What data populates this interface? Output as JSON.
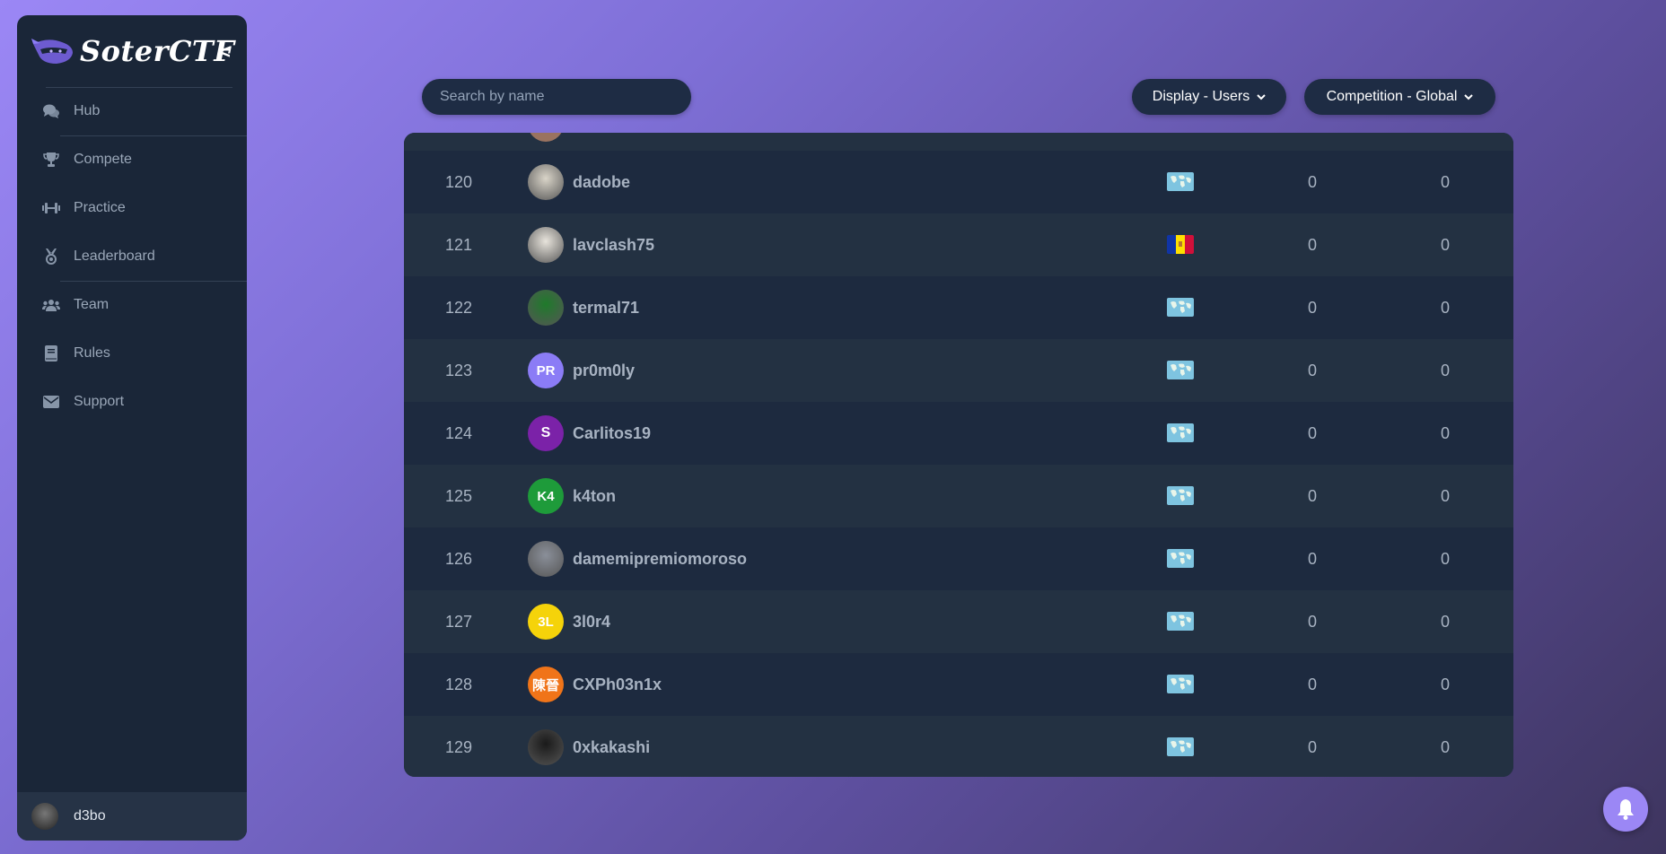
{
  "brand": {
    "name": "SoterCTF",
    "collapse_label": "<"
  },
  "nav": [
    {
      "label": "Hub",
      "icon": "chat-bubbles-icon"
    },
    {
      "label": "Compete",
      "icon": "trophy-icon"
    },
    {
      "label": "Practice",
      "icon": "dumbbell-icon"
    },
    {
      "label": "Leaderboard",
      "icon": "medal-icon"
    },
    {
      "label": "Team",
      "icon": "users-icon"
    },
    {
      "label": "Rules",
      "icon": "book-icon"
    },
    {
      "label": "Support",
      "icon": "envelope-icon"
    }
  ],
  "user": {
    "name": "d3bo"
  },
  "search": {
    "placeholder": "Search by name",
    "value": ""
  },
  "filters": {
    "display": "Display - Users",
    "competition": "Competition - Global"
  },
  "colors": {
    "accent": "#9b87f5",
    "sidebar_bg": "#1a2638",
    "table_bg": "#1d2a3f",
    "row_alt": "#233142"
  },
  "rows": [
    {
      "rank": "120",
      "name": "dadobe",
      "flag": "world",
      "score_a": "0",
      "score_b": "0",
      "avatar": {
        "type": "photo",
        "color": "#d9d4c8",
        "text": ""
      }
    },
    {
      "rank": "121",
      "name": "lavclash75",
      "flag": "andorra",
      "score_a": "0",
      "score_b": "0",
      "avatar": {
        "type": "photo",
        "color": "#e8e4dc",
        "text": ""
      }
    },
    {
      "rank": "122",
      "name": "termal71",
      "flag": "world",
      "score_a": "0",
      "score_b": "0",
      "avatar": {
        "type": "photo",
        "color": "#1f7a2b",
        "text": ""
      }
    },
    {
      "rank": "123",
      "name": "pr0m0ly",
      "flag": "world",
      "score_a": "0",
      "score_b": "0",
      "avatar": {
        "type": "initials",
        "color": "#8b7cf6",
        "text": "PR"
      }
    },
    {
      "rank": "124",
      "name": "Carlitos19",
      "flag": "world",
      "score_a": "0",
      "score_b": "0",
      "avatar": {
        "type": "initials",
        "color": "#7b22a8",
        "text": "S"
      }
    },
    {
      "rank": "125",
      "name": "k4ton",
      "flag": "world",
      "score_a": "0",
      "score_b": "0",
      "avatar": {
        "type": "initials",
        "color": "#1e9b3a",
        "text": "K4"
      }
    },
    {
      "rank": "126",
      "name": "damemipremiomoroso",
      "flag": "world",
      "score_a": "0",
      "score_b": "0",
      "avatar": {
        "type": "photo",
        "color": "#8a8f99",
        "text": ""
      }
    },
    {
      "rank": "127",
      "name": "3l0r4",
      "flag": "world",
      "score_a": "0",
      "score_b": "0",
      "avatar": {
        "type": "initials",
        "color": "#f5d30a",
        "text": "3L"
      }
    },
    {
      "rank": "128",
      "name": "CXPh03n1x",
      "flag": "world",
      "score_a": "0",
      "score_b": "0",
      "avatar": {
        "type": "initials",
        "color": "#f07419",
        "text": "陳晉"
      }
    },
    {
      "rank": "129",
      "name": "0xkakashi",
      "flag": "world",
      "score_a": "0",
      "score_b": "0",
      "avatar": {
        "type": "photo",
        "color": "#1a1a1a",
        "text": ""
      }
    }
  ]
}
